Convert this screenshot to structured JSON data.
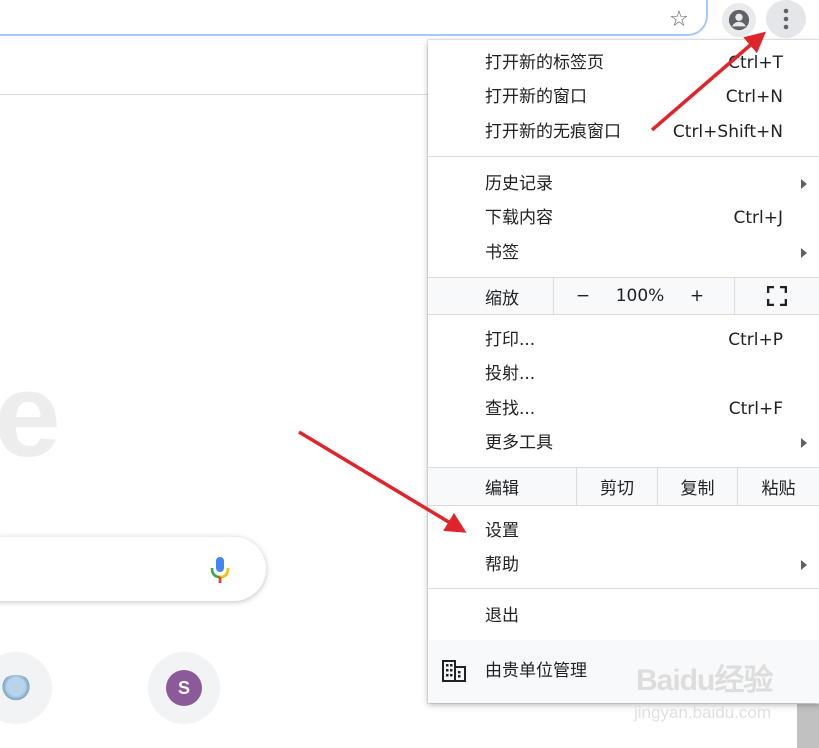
{
  "colors": {
    "arrow": "#e0242c",
    "menu_bg": "#ffffff",
    "row_alt_bg": "#f8f9fa",
    "separator": "#dadce0",
    "shortcut_avatar": "#8b5a9a"
  },
  "toolbar": {
    "icons": [
      "star-icon",
      "person-icon",
      "more-vert-icon"
    ]
  },
  "newtab": {
    "logo_fragment": "e",
    "shortcut_letter": "S"
  },
  "menu": {
    "group1": [
      {
        "label": "打开新的标签页",
        "shortcut": "Ctrl+T"
      },
      {
        "label": "打开新的窗口",
        "shortcut": "Ctrl+N"
      },
      {
        "label": "打开新的无痕窗口",
        "shortcut": "Ctrl+Shift+N"
      }
    ],
    "group2": [
      {
        "label": "历史记录",
        "shortcut": ""
      },
      {
        "label": "下载内容",
        "shortcut": "Ctrl+J"
      },
      {
        "label": "书签",
        "shortcut": ""
      }
    ],
    "zoom": {
      "label": "缩放",
      "minus": "−",
      "value": "100%",
      "plus": "+"
    },
    "group3": [
      {
        "label": "打印...",
        "shortcut": "Ctrl+P"
      },
      {
        "label": "投射...",
        "shortcut": ""
      },
      {
        "label": "查找...",
        "shortcut": "Ctrl+F"
      },
      {
        "label": "更多工具",
        "shortcut": ""
      }
    ],
    "edit": {
      "label": "编辑",
      "cut": "剪切",
      "copy": "复制",
      "paste": "粘贴"
    },
    "group4": [
      {
        "label": "设置",
        "shortcut": ""
      },
      {
        "label": "帮助",
        "shortcut": ""
      }
    ],
    "exit": {
      "label": "退出"
    },
    "managed": {
      "label": "由贵单位管理"
    }
  },
  "watermark": {
    "brand": "Baidu经验",
    "url": "jingyan.baidu.com"
  }
}
